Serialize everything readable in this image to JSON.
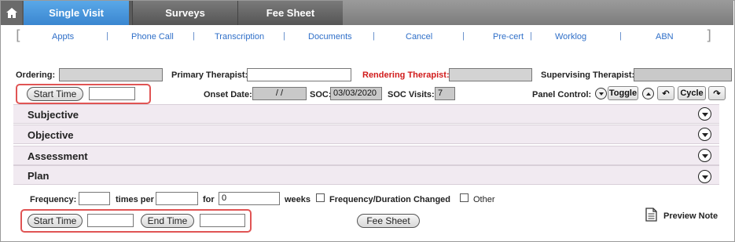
{
  "tabs": [
    {
      "label": "Single Visit"
    },
    {
      "label": "Surveys"
    },
    {
      "label": "Fee Sheet"
    }
  ],
  "subnav": {
    "items": [
      "Appts",
      "Phone Call",
      "Transcription",
      "Documents",
      "Cancel",
      "Pre-cert",
      "Worklog",
      "ABN"
    ]
  },
  "header": {
    "ordering_label": "Ordering:",
    "primary_label": "Primary Therapist:",
    "primary_value": "",
    "rendering_label": "Rendering Therapist:",
    "supervising_label": "Supervising Therapist:",
    "supervising_value": "",
    "start_time_label": "Start Time",
    "start_time_value": "",
    "onset_label": "Onset Date:",
    "onset_value": "  /  /",
    "soc_label": "SOC:",
    "soc_value": "03/03/2020",
    "soc_visits_label": "SOC Visits:",
    "soc_visits_value": "7",
    "panel_control_label": "Panel Control:",
    "toggle_label": "Toggle",
    "cycle_label": "Cycle"
  },
  "panels": [
    "Subjective",
    "Objective",
    "Assessment",
    "Plan"
  ],
  "plan": {
    "frequency_label": "Frequency:",
    "frequency_value": "",
    "times_per_label": "times per",
    "times_per_value": "",
    "for_label": "for",
    "for_value": "0",
    "weeks_label": "weeks",
    "freq_changed_label": "Frequency/Duration Changed",
    "other_label": "Other"
  },
  "footer": {
    "start_time_label": "Start Time",
    "start_time_value": "",
    "end_time_label": "End Time",
    "end_time_value": "",
    "fee_sheet_label": "Fee Sheet",
    "preview_label": "Preview Note"
  },
  "colors": {
    "accent_tab": "#3a86d0",
    "link": "#2f6fc8",
    "rendering_label": "#d11b1b",
    "highlight": "#e05454",
    "panel_bg": "#f1eaf1"
  }
}
